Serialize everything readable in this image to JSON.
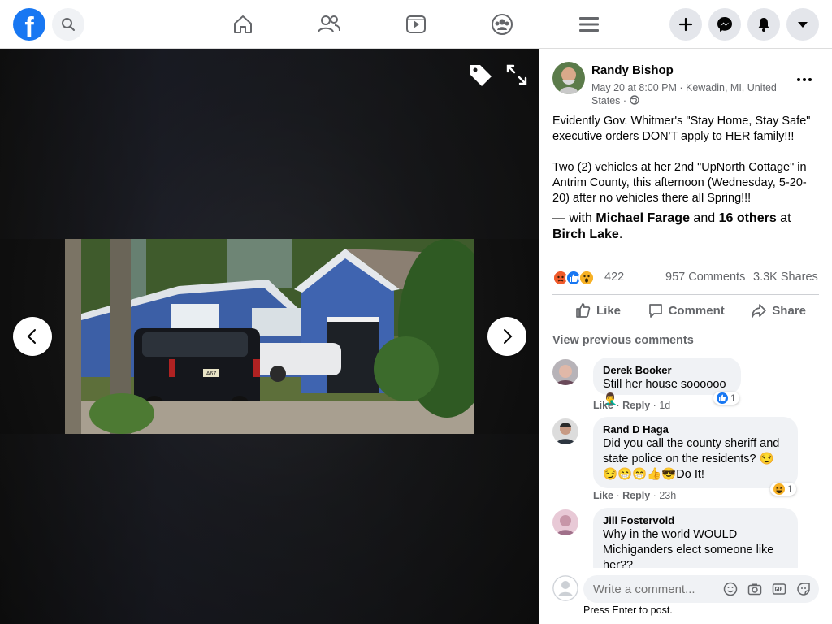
{
  "topbar": {
    "logo": "f",
    "icons": [
      "search-icon",
      "home-icon",
      "friends-icon",
      "watch-icon",
      "groups-icon",
      "menu-icon",
      "plus-icon",
      "messenger-icon",
      "notifications-icon",
      "account-caret-icon"
    ]
  },
  "viewer": {
    "tag_icon": "tag-icon",
    "expand_icon": "expand-icon",
    "prev_icon": "chevron-left-icon",
    "next_icon": "chevron-right-icon",
    "photo_plate": "A67"
  },
  "post": {
    "author": "Randy Bishop",
    "meta_line": "May 20 at 8:00 PM · Kewadin, MI, United States ·",
    "text_p1": "Evidently Gov. Whitmer's \"Stay Home, Stay Safe\" executive orders DON'T apply to HER family!!!",
    "text_p2": "Two (2) vehicles at her 2nd \"UpNorth Cottage\" in Antrim County, this afternoon (Wednesday, 5-20-20) after no vehicles there all Spring!!!",
    "with_prefix": "— with",
    "with_person": "Michael Farage",
    "with_and": "and",
    "with_others": "16 others",
    "with_at": "at",
    "with_place": "Birch Lake",
    "with_end": ".",
    "reaction_count": "422",
    "comments_count": "957 Comments",
    "shares_count": "3.3K Shares"
  },
  "actions": {
    "like": "Like",
    "comment": "Comment",
    "share": "Share"
  },
  "comments": {
    "view_previous": "View previous comments",
    "items": [
      {
        "name": "Derek Booker",
        "text": "Still her house soooooo🤦‍♂️",
        "like": "Like",
        "reply": "Reply",
        "time": "1d",
        "reaction_count": "1"
      },
      {
        "name": "Rand D Haga",
        "text": "Did you call the county sheriff and state police on the residents? 😏😏😁😁👍😎Do It!",
        "like": "Like",
        "reply": "Reply",
        "time": "23h",
        "reaction_count": "1"
      },
      {
        "name": "Jill Fostervold",
        "text": "Why in the world WOULD Michiganders elect someone like her??"
      }
    ]
  },
  "composer": {
    "placeholder": "Write a comment...",
    "hint": "Press Enter to post."
  },
  "colors": {
    "brand": "#1877f2",
    "panel_bg": "#ffffff",
    "bubble": "#f0f2f5",
    "muted": "#65676b"
  }
}
